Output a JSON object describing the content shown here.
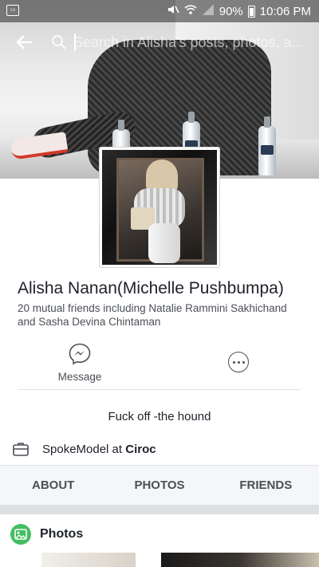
{
  "status_bar": {
    "battery": "90%",
    "time": "10:06 PM"
  },
  "header": {
    "back_icon": "arrow-left-icon",
    "search_placeholder": "Search in Alisha's posts, photos, a..."
  },
  "profile": {
    "name": "Alisha Nanan",
    "alternate_name": "(Michelle Pushbumpa)",
    "mutual_friends": "20 mutual friends including Natalie Rammini Sakhichand and Sasha Devina Chintaman",
    "bio": "Fuck off -the hound",
    "work_prefix": "SpokeModel at ",
    "work_company": "Ciroc"
  },
  "actions": {
    "message_label": "Message",
    "message_icon": "messenger-icon",
    "more_icon": "more-icon"
  },
  "tabs": [
    {
      "label": "ABOUT"
    },
    {
      "label": "PHOTOS"
    },
    {
      "label": "FRIENDS"
    }
  ],
  "photos_section": {
    "title": "Photos",
    "icon": "photos-icon"
  },
  "colors": {
    "photos_green": "#45bd62",
    "tab_bar": "#f5f6f7",
    "text_primary": "#1d2129",
    "text_secondary": "#4b4f56"
  }
}
